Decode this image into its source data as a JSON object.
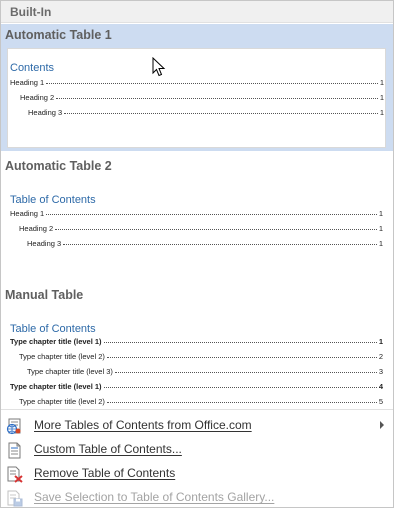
{
  "section_header": "Built-In",
  "galleries": [
    {
      "title": "Automatic Table 1",
      "toc_title": "Contents",
      "lines": [
        {
          "text": "Heading 1",
          "page": "1"
        },
        {
          "text": "Heading 2",
          "page": "1"
        },
        {
          "text": "Heading 3",
          "page": "1"
        }
      ]
    },
    {
      "title": "Automatic Table 2",
      "toc_title": "Table of Contents",
      "lines": [
        {
          "text": "Heading 1",
          "page": "1"
        },
        {
          "text": "Heading 2",
          "page": "1"
        },
        {
          "text": "Heading 3",
          "page": "1"
        }
      ]
    },
    {
      "title": "Manual Table",
      "toc_title": "Table of Contents",
      "lines": [
        {
          "text": "Type chapter title (level 1)",
          "page": "1"
        },
        {
          "text": "Type chapter title (level 2)",
          "page": "2"
        },
        {
          "text": "Type chapter title (level 3)",
          "page": "3"
        },
        {
          "text": "Type chapter title (level 1)",
          "page": "4"
        },
        {
          "text": "Type chapter title (level 2)",
          "page": "5"
        }
      ]
    }
  ],
  "menu": [
    {
      "label": "More Tables of Contents from Office.com",
      "icon": "office-toc-icon",
      "has_submenu": true,
      "enabled": true
    },
    {
      "label": "Custom Table of Contents...",
      "icon": "document-icon",
      "has_submenu": false,
      "enabled": true
    },
    {
      "label": "Remove Table of Contents",
      "icon": "remove-toc-icon",
      "has_submenu": false,
      "enabled": true
    },
    {
      "label": "Save Selection to Table of Contents Gallery...",
      "icon": "save-gallery-icon",
      "has_submenu": false,
      "enabled": false
    }
  ],
  "colors": {
    "selected_bg": "#cddcf1",
    "toc_title": "#2e6aa8",
    "header_bg": "#f0f0f0",
    "disabled_text": "#a3a3a3"
  }
}
